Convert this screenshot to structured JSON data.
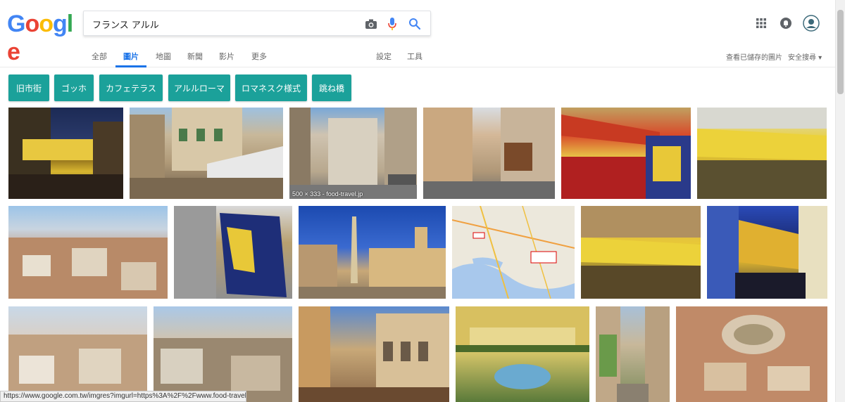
{
  "logo": {
    "letters": [
      "G",
      "o",
      "o",
      "g",
      "l",
      "e"
    ],
    "colors": [
      "#4285F4",
      "#EA4335",
      "#FBBC05",
      "#4285F4",
      "#34A853",
      "#EA4335"
    ]
  },
  "search": {
    "value": "フランス アルル"
  },
  "icons": {
    "camera": "camera-icon",
    "mic": "mic-icon",
    "search": "search-icon",
    "apps": "apps-grid-icon",
    "notify": "notifications-icon",
    "avatar": "avatar"
  },
  "tabs": {
    "all": "全部",
    "images": "圖片",
    "maps": "地圖",
    "news": "新聞",
    "videos": "影片",
    "more": "更多",
    "settings": "設定",
    "tools": "工具",
    "saved": "查看已儲存的圖片",
    "safesearch": "安全搜尋 ▾"
  },
  "chips": [
    "旧市街",
    "ゴッホ",
    "カフェテラス",
    "アルルローマ",
    "ロマネスク様式",
    "跳ね橋"
  ],
  "images": {
    "caption_r1_3": "500 × 333 - food-travel.jp"
  },
  "status_url": "https://www.google.com.tw/imgres?imgurl=https%3A%2F%2Fwww.food-travel.jp%2Ffr...",
  "colors": {
    "accent": "#1a73e8",
    "chip": "#1ba19a"
  }
}
